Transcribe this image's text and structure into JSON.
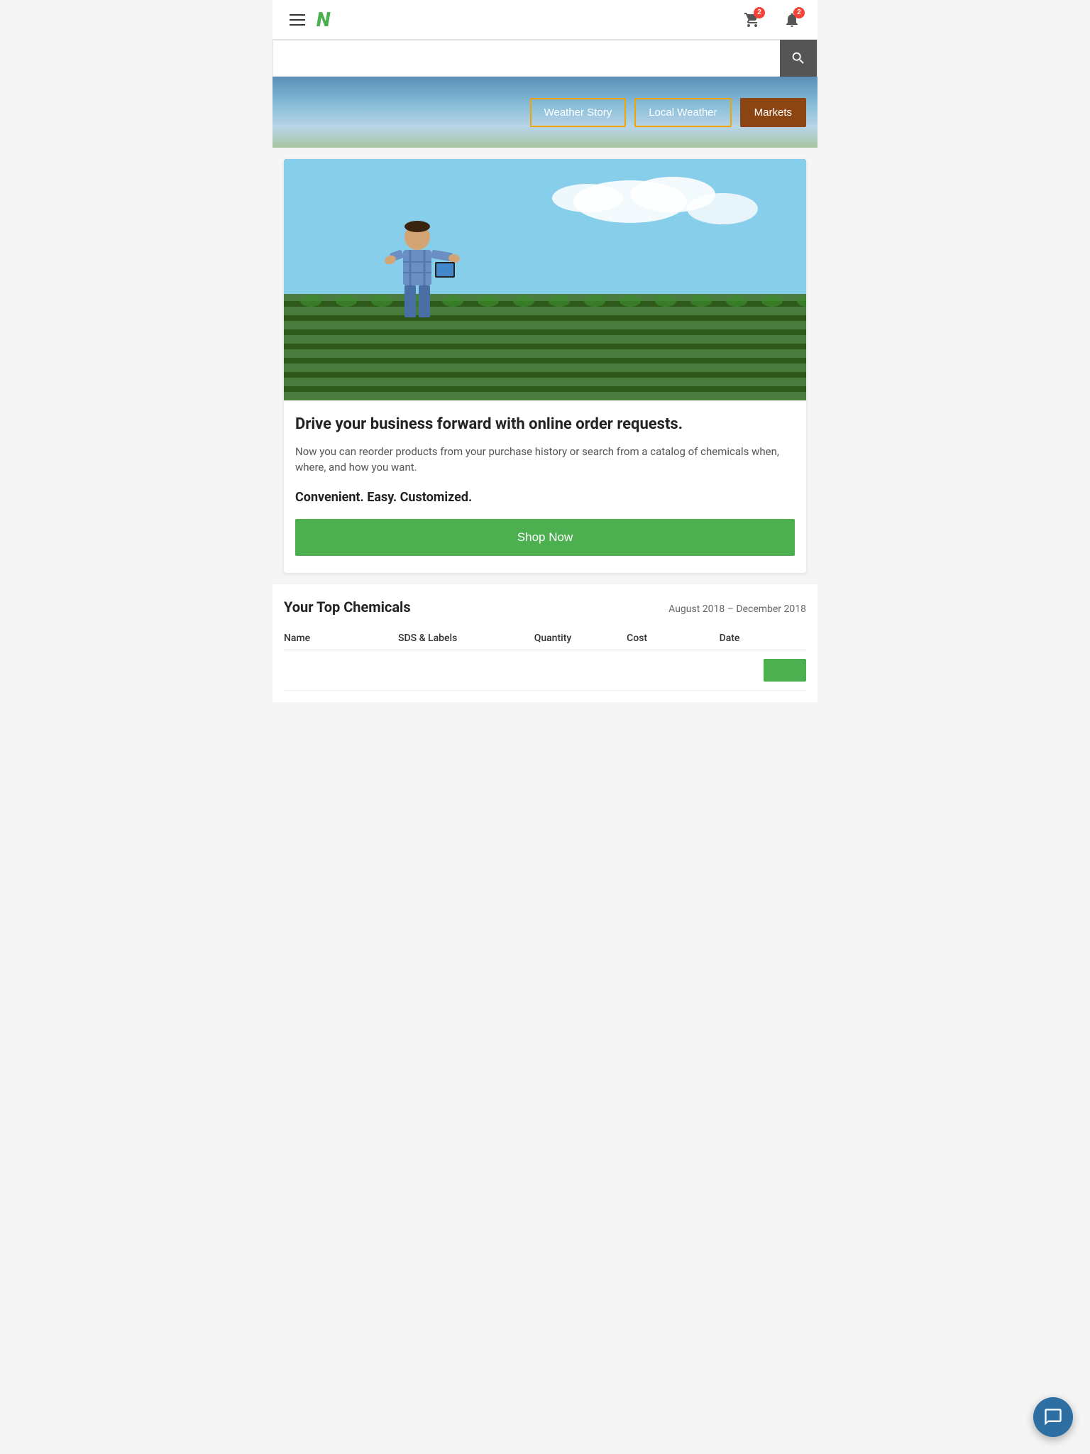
{
  "header": {
    "logo_letter": "N",
    "cart_badge": "2",
    "bell_badge": "2"
  },
  "search": {
    "placeholder": ""
  },
  "weather": {
    "weather_story_label": "Weather Story",
    "local_weather_label": "Local Weather",
    "markets_label": "Markets"
  },
  "hero": {
    "headline": "Drive your business forward with online order requests.",
    "subtext": "Now you can reorder products from your purchase history or search from a catalog of chemicals when, where, and how you want.",
    "tagline": "Convenient. Easy. Customized.",
    "shop_button": "Shop Now"
  },
  "chemicals": {
    "title": "Your Top Chemicals",
    "date_range": "August 2018 – December 2018",
    "columns": [
      "Name",
      "SDS & Labels",
      "Quantity",
      "Cost",
      "Date"
    ]
  }
}
